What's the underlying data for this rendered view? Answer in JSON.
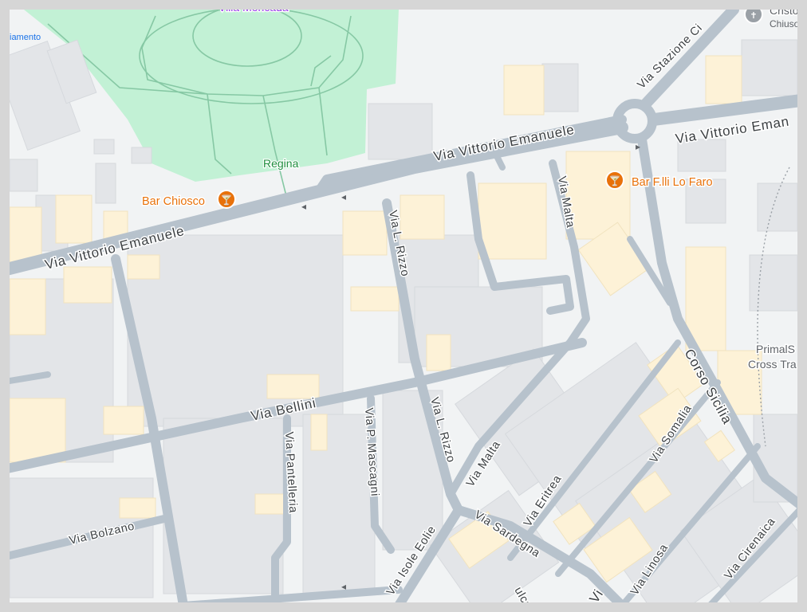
{
  "colors": {
    "background": "#f1f3f4",
    "road": "#b7c2cc",
    "building": "#e3e5e8",
    "commercial_building": "#fdf2d7",
    "park": "#c2f1d5",
    "poi": "#e8710a"
  },
  "park": {
    "name": "Villa Moncada",
    "sub_label": "Regina"
  },
  "pois": [
    {
      "name": "Bar Chiosco",
      "icon": "cocktail-icon"
    },
    {
      "name": "Bar F.lli Lo Faro",
      "icon": "cocktail-icon"
    }
  ],
  "partial_poi": {
    "name": "Cristo",
    "sub": "Chiuso",
    "icon": "church-icon"
  },
  "streets": {
    "vittorio_emanuele_west": "Via Vittorio Emanuele",
    "vittorio_emanuele_center": "Via Vittorio Emanuele",
    "vittorio_emanuele_east": "Via Vittorio Eman",
    "stazione": "Via Stazione Ci",
    "rizzo_north": "Via L. Rizzo",
    "rizzo_south": "Via L. Rizzo",
    "malta_north": "Via Malta",
    "malta_south": "Via Malta",
    "bellini": "Via Bellini",
    "pantelleria": "Via Pantelleria",
    "mascagni": "Via P. Mascagni",
    "bolzano": "Via Bolzano",
    "isole_eolie": "Via Isole Eolie",
    "sardegna": "Via Sardegna",
    "eritrea": "Via Eritrea",
    "somalia": "Via Somalia",
    "linosa": "Via Linosa",
    "cirenaica": "Via Cirenaica",
    "corso_sicilia": "Corso Sicilia",
    "vulcano": "ulcano",
    "bottom_partial": "Vi"
  },
  "edge_labels": {
    "top_left": "iamento",
    "primal_1": "PrimalS",
    "primal_2": "Cross Tra"
  }
}
